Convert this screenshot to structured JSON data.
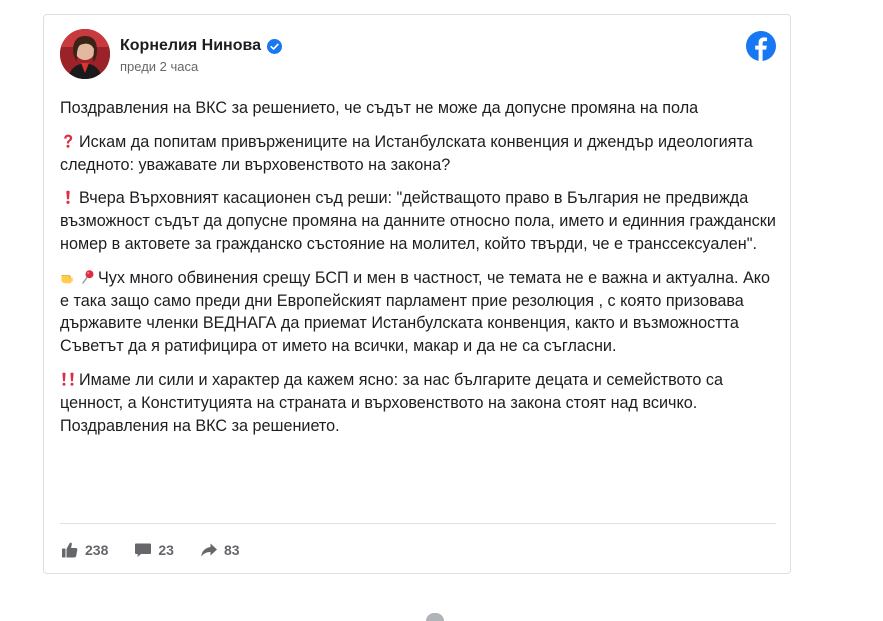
{
  "post": {
    "author": "Корнелия Нинова",
    "time": "преди 2 часа",
    "paragraphs": [
      "Поздравления на ВКС за решението, че съдът не може да допусне промяна на пола",
      "Искам да попитам привържениците на Истанбулската конвенция и джендър идеологията следното: уважавате ли върховенството на закона?",
      "Вчера Върховният касационен съд реши: \"действащото право в България не предвижда възможност съдът да допусне промяна на данните относно пола, името и единния граждански номер в актовете за гражданско състояние на молител, който твърди, че е транссексуален\".",
      "Чух много обвинения срещу БСП и мен в частност, че темата не е важна и актуална. Ако е така защо само преди дни Европейският парламент прие резолюция , с която призовава държавите членки ВЕДНАГА да приемат Истанбулската конвенция, както и възможността Съветът да я ратифицира от името на всички, макар и да не са съгласни.",
      "Имаме ли сили и характер да кажем ясно: за нас българите децата и семейството са ценност, а Конституцията на страната и върховенството на закона стоят над всичко. Поздравления на ВКС за решението."
    ],
    "emoji_icons": [
      "question-mark-icon",
      "exclamation-icon",
      "pointing-hand-icon",
      "pushpin-icon",
      "double-exclamation-icon"
    ]
  },
  "stats": {
    "likes": "238",
    "comments": "23",
    "shares": "83"
  },
  "colors": {
    "facebook_blue": "#1877f2",
    "red_emoji": "#dd2e44",
    "muted_text": "#65676b",
    "border": "#dddfe2"
  }
}
